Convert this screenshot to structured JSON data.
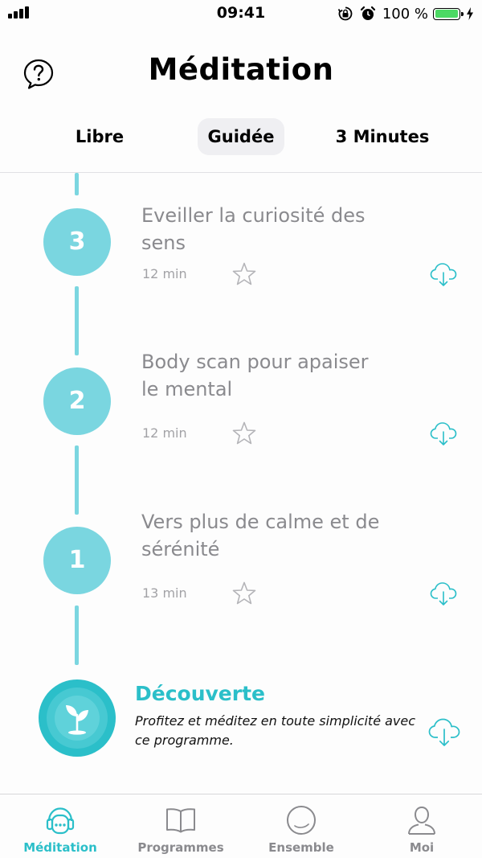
{
  "status_bar": {
    "time": "09:41",
    "battery_percent": "100 %",
    "battery_level": 1.0
  },
  "header": {
    "title": "Méditation",
    "help_icon": "question-bubble-icon"
  },
  "tabs": [
    {
      "label": "Libre",
      "selected": false
    },
    {
      "label": "Guidée",
      "selected": true
    },
    {
      "label": "3 Minutes",
      "selected": false
    }
  ],
  "sessions": [
    {
      "number": "3",
      "title": "Eveiller la curiosité des sens",
      "duration": "12 min",
      "starred": false
    },
    {
      "number": "2",
      "title": "Body scan pour apaiser le mental",
      "duration": "12 min",
      "starred": false
    },
    {
      "number": "1",
      "title": "Vers plus de calme et de sérénité",
      "duration": "13 min",
      "starred": false
    }
  ],
  "program": {
    "title": "Découverte",
    "description": "Profitez et méditez en toute simplicité avec ce programme."
  },
  "tabbar": [
    {
      "label": "Méditation",
      "icon": "headphones-face-icon",
      "active": true
    },
    {
      "label": "Programmes",
      "icon": "book-icon",
      "active": false
    },
    {
      "label": "Ensemble",
      "icon": "circle-icon",
      "active": false
    },
    {
      "label": "Moi",
      "icon": "person-icon",
      "active": false
    }
  ],
  "colors": {
    "accent": "#2bbfc9",
    "timeline": "#7ad6e0",
    "muted_text": "#8a8a8e",
    "tab_selected_bg": "#efeff2",
    "battery_green": "#4cd964"
  }
}
